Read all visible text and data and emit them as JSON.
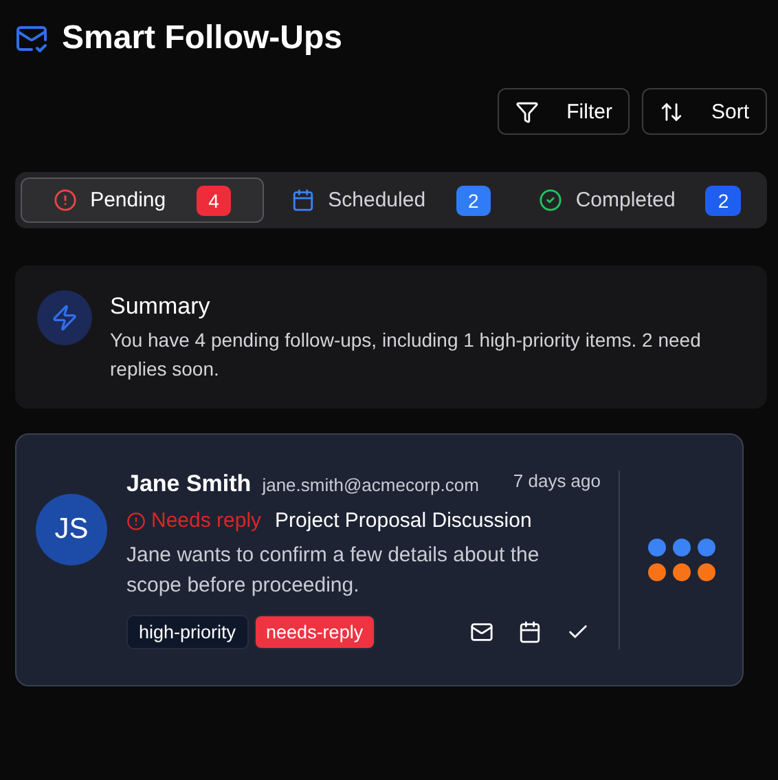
{
  "header": {
    "title": "Smart Follow-Ups"
  },
  "toolbar": [
    {
      "kind": "filter",
      "label": "Filter"
    },
    {
      "kind": "sort",
      "label": "Sort"
    }
  ],
  "tabs": [
    {
      "kind": "pending",
      "label": "Pending",
      "count": "4",
      "selected": true
    },
    {
      "kind": "scheduled",
      "label": "Scheduled",
      "count": "2",
      "selected": false
    },
    {
      "kind": "completed",
      "label": "Completed",
      "count": "2",
      "selected": false
    }
  ],
  "summary": {
    "title": "Summary",
    "text": "You have 4 pending follow-ups, including 1 high-priority items. 2 need replies soon."
  },
  "followups": [
    {
      "initials": "JS",
      "name": "Jane Smith",
      "email": "jane.smith@acmecorp.com",
      "time": "7 days ago",
      "status": "Needs reply",
      "subject": "Project Proposal Discussion",
      "body": "Jane wants to confirm a few details about the scope before proceeding.",
      "tags": [
        {
          "label": "high-priority",
          "color": "#0f172a"
        },
        {
          "label": "needs-reply",
          "color": "#ef3340"
        }
      ]
    }
  ]
}
